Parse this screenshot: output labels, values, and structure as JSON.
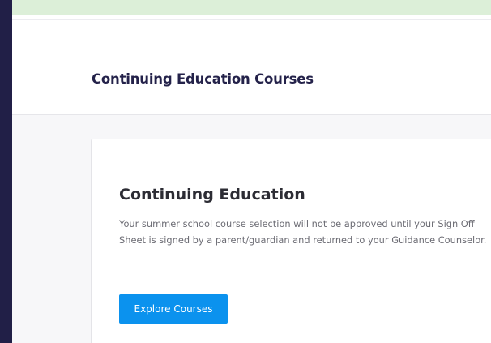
{
  "header": {
    "title": "Continuing Education Courses"
  },
  "card": {
    "title": "Continuing Education",
    "body": "Your summer school course selection will not be approved until your Sign Off Sheet is signed by a parent/guardian and returned to your Guidance Counselor.",
    "button_label": "Explore Courses"
  },
  "colors": {
    "sidebar": "#211f47",
    "top_border": "#dcefd8",
    "button": "#0b92ee",
    "title": "#24224a"
  }
}
